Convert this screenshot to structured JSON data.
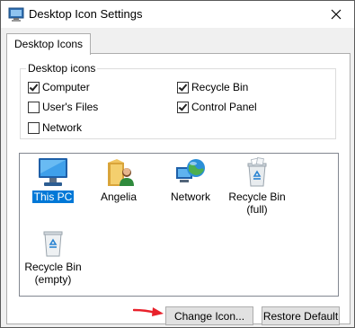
{
  "window": {
    "title": "Desktop Icon Settings",
    "tabs": [
      {
        "label": "Desktop Icons",
        "active": true
      }
    ]
  },
  "desktop_icons_group": {
    "legend": "Desktop icons",
    "checkboxes": [
      {
        "label": "Computer",
        "checked": true
      },
      {
        "label": "Recycle Bin",
        "checked": true
      },
      {
        "label": "User's Files",
        "checked": false
      },
      {
        "label": "Control Panel",
        "checked": true
      },
      {
        "label": "Network",
        "checked": false
      }
    ]
  },
  "icon_list": {
    "items": [
      {
        "label": "This PC",
        "icon": "monitor-icon",
        "selected": true
      },
      {
        "label": "Angelia",
        "icon": "user-folder-icon",
        "selected": false
      },
      {
        "label": "Network",
        "icon": "network-globe-icon",
        "selected": false
      },
      {
        "label": "Recycle Bin\n(full)",
        "icon": "recycle-bin-full-icon",
        "selected": false
      },
      {
        "label": "Recycle Bin\n(empty)",
        "icon": "recycle-bin-empty-icon",
        "selected": false
      }
    ]
  },
  "buttons": {
    "change_icon": "Change Icon...",
    "restore_default": "Restore Default"
  },
  "colors": {
    "selection": "#0078d7",
    "annotation_arrow": "#e8212b"
  }
}
